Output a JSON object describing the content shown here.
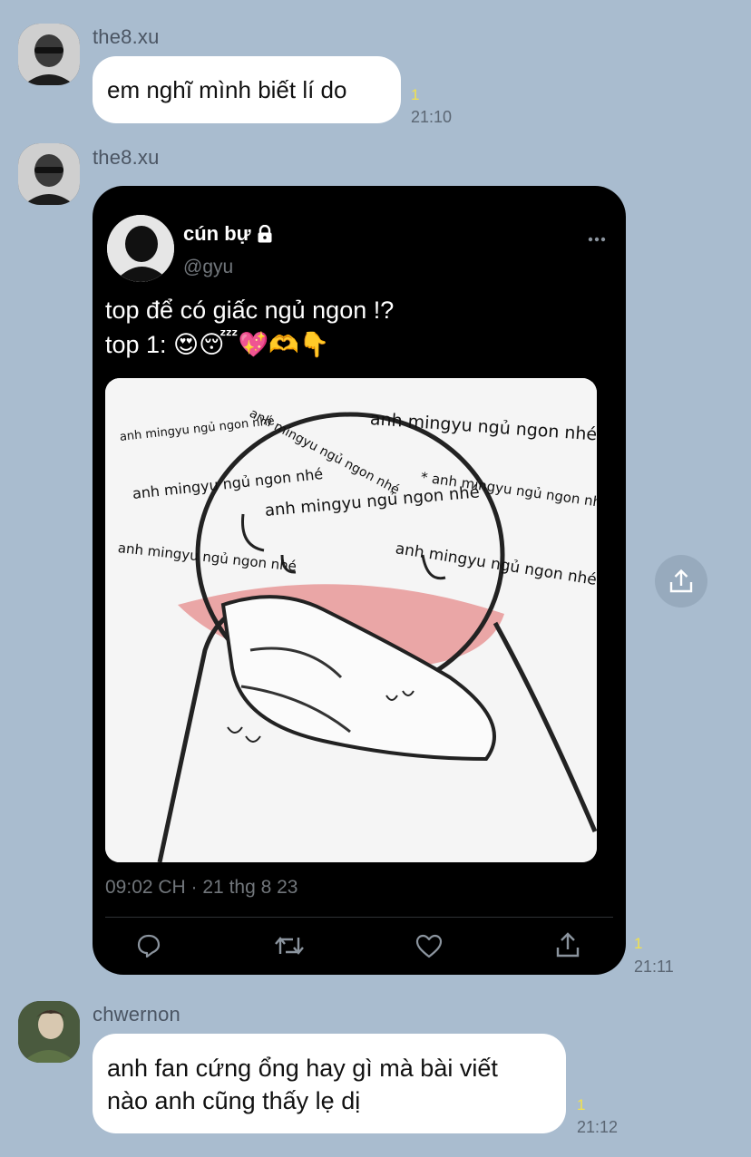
{
  "messages": [
    {
      "sender": "the8.xu",
      "text": "em nghĩ mình biết lí do",
      "unread": "1",
      "time": "21:10"
    },
    {
      "sender": "the8.xu",
      "unread": "1",
      "time": "21:11",
      "tweet": {
        "name": "cún bự",
        "handle": "@gyu",
        "text_line1": "top để có giấc ngủ ngon !?",
        "text_line2": "top 1: 😍😴💖🫶👇",
        "timestamp": "09:02 CH · 21 thg 8 23",
        "image_texts": [
          "anh mingyu ngủ ngon nhé",
          "anh mingyu ngủ ngon nhé",
          "anh mingyu ngủ ngon nhé",
          "anh mingyu ngủ ngon nhé",
          "* anh mingyu ngủ ngon nhé",
          "anh mingyu ngủ ngon nhé",
          "anh mingyu ngủ ngon nhé",
          "anh mingyu ngủ ngon nhé"
        ]
      }
    },
    {
      "sender": "chwernon",
      "text_line1": "anh fan cứng ổng hay gì mà bài viết",
      "text_line2": "nào anh cũng thấy lẹ dị",
      "unread": "1",
      "time": "21:12"
    }
  ],
  "icons": {
    "lock": "lock-icon",
    "more": "more-icon",
    "reply": "reply-icon",
    "retweet": "retweet-icon",
    "like": "heart-icon",
    "share": "share-icon"
  }
}
